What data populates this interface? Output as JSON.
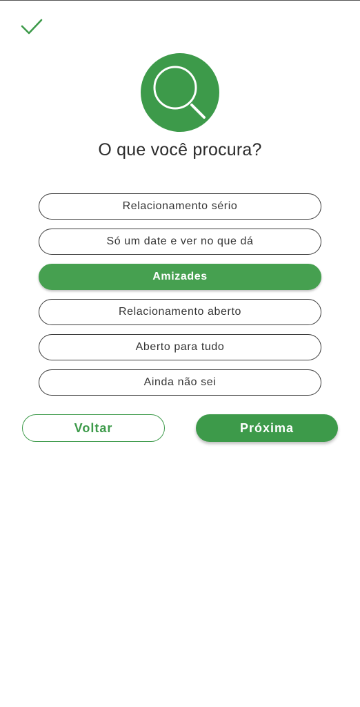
{
  "header": {
    "confirm_icon": "check-icon",
    "search_icon": "search-icon"
  },
  "title": "O que você procura?",
  "options": [
    {
      "label": "Relacionamento sério",
      "selected": false
    },
    {
      "label": "Só um date e ver no que dá",
      "selected": false
    },
    {
      "label": "Amizades",
      "selected": true
    },
    {
      "label": "Relacionamento aberto",
      "selected": false
    },
    {
      "label": "Aberto para tudo",
      "selected": false
    },
    {
      "label": "Ainda não sei",
      "selected": false
    }
  ],
  "buttons": {
    "back_label": "Voltar",
    "next_label": "Próxima"
  },
  "colors": {
    "accent": "#3d9a4a",
    "selected_option": "#46a050",
    "text": "#2b2b2b"
  }
}
